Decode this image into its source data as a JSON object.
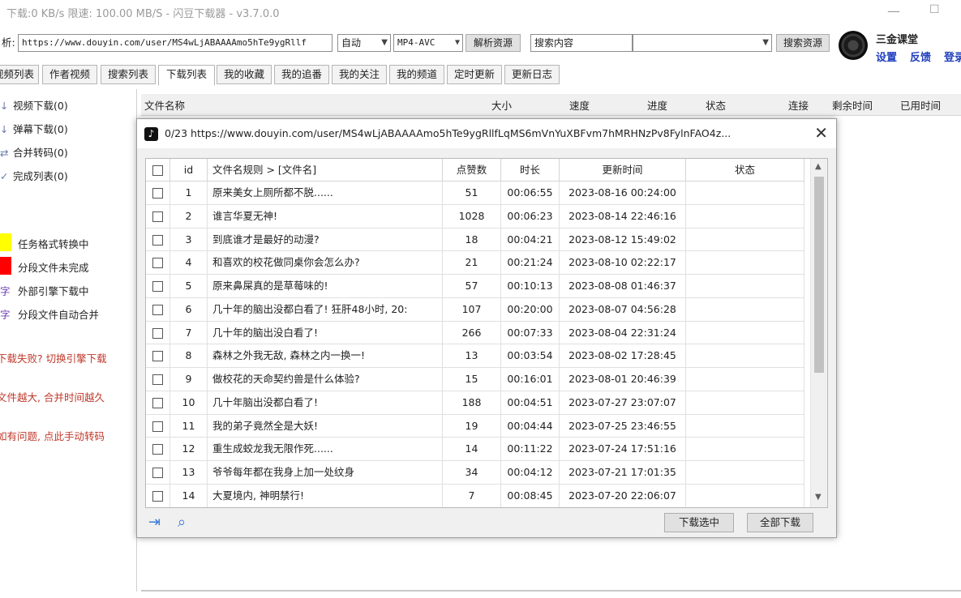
{
  "window": {
    "title": "下载:0 KB/s  限速: 100.00 MB/S  - 闪豆下载器 - v3.7.0.0"
  },
  "toolbar": {
    "parse_label_fragment": "析:",
    "url_value": "https://www.douyin.com/user/MS4wLjABAAAAmo5hTe9ygRllf",
    "mode_value": "自动",
    "format_value": "MP4-AVC",
    "parse_button": "解析资源",
    "search_value": "搜索内容",
    "search_button": "搜索资源"
  },
  "user": {
    "name": "三金课堂",
    "settings": "设置",
    "feedback": "反馈",
    "login_fragment": "登录"
  },
  "tabs": [
    "视频列表",
    "作者视频",
    "搜索列表",
    "下载列表",
    "我的收藏",
    "我的追番",
    "我的关注",
    "我的频道",
    "定时更新",
    "更新日志"
  ],
  "active_tab_index": 3,
  "left_panel": {
    "items": [
      {
        "icon": "arrow-down-icon",
        "glyph": "↓",
        "label": "视频下载(0)"
      },
      {
        "icon": "arrow-down-icon",
        "glyph": "↓",
        "label": "弹幕下载(0)"
      },
      {
        "icon": "merge-icon",
        "glyph": "⇄",
        "label": "合并转码(0)"
      },
      {
        "icon": "check-icon",
        "glyph": "✓",
        "label": "完成列表(0)"
      }
    ],
    "legend": [
      {
        "color": "#ffff00",
        "label": "任务格式转换中"
      },
      {
        "color": "#ff0000",
        "label": "分段文件未完成"
      },
      {
        "glyph": "字",
        "glyph_color": "#6c3fb5",
        "label": "外部引擎下载中"
      },
      {
        "glyph": "字",
        "glyph_color": "#6c3fb5",
        "label": "分段文件自动合并"
      }
    ],
    "hints": [
      "下载失败? 切换引擎下载",
      "文件越大, 合并时间越久",
      "如有问题, 点此手动转码"
    ]
  },
  "main_header": [
    "文件名称",
    "大小",
    "速度",
    "进度",
    "状态",
    "连接",
    "剩余时间",
    "已用时间"
  ],
  "dialog": {
    "title": "0/23 https://www.douyin.com/user/MS4wLjABAAAAmo5hTe9ygRllfLqMS6mVnYuXBFvm7hMRHNzPv8FylnFAO4z...",
    "columns": [
      "",
      "id",
      "文件名规则  >  [文件名]",
      "点赞数",
      "时长",
      "更新时间",
      "状态"
    ],
    "rows": [
      {
        "id": "1",
        "name": "原来美女上厕所都不脱......",
        "likes": "51",
        "duration": "00:06:55",
        "updated": "2023-08-16 00:24:00",
        "status": ""
      },
      {
        "id": "2",
        "name": "谁言华夏无神!",
        "likes": "1028",
        "duration": "00:06:23",
        "updated": "2023-08-14 22:46:16",
        "status": ""
      },
      {
        "id": "3",
        "name": "到底谁才是最好的动漫?",
        "likes": "18",
        "duration": "00:04:21",
        "updated": "2023-08-12 15:49:02",
        "status": ""
      },
      {
        "id": "4",
        "name": "和喜欢的校花做同桌你会怎么办?",
        "likes": "21",
        "duration": "00:21:24",
        "updated": "2023-08-10 02:22:17",
        "status": ""
      },
      {
        "id": "5",
        "name": "原来鼻屎真的是草莓味的!",
        "likes": "57",
        "duration": "00:10:13",
        "updated": "2023-08-08 01:46:37",
        "status": ""
      },
      {
        "id": "6",
        "name": "几十年的脑出没都白看了! 狂肝48小时, 20:",
        "likes": "107",
        "duration": "00:20:00",
        "updated": "2023-08-07 04:56:28",
        "status": ""
      },
      {
        "id": "7",
        "name": "几十年的脑出没白看了!",
        "likes": "266",
        "duration": "00:07:33",
        "updated": "2023-08-04 22:31:24",
        "status": ""
      },
      {
        "id": "8",
        "name": "森林之外我无敌, 森林之内一换一!",
        "likes": "13",
        "duration": "00:03:54",
        "updated": "2023-08-02 17:28:45",
        "status": ""
      },
      {
        "id": "9",
        "name": "做校花的天命契约兽是什么体验?",
        "likes": "15",
        "duration": "00:16:01",
        "updated": "2023-08-01 20:46:39",
        "status": ""
      },
      {
        "id": "10",
        "name": "几十年脑出没都白看了!",
        "likes": "188",
        "duration": "00:04:51",
        "updated": "2023-07-27 23:07:07",
        "status": ""
      },
      {
        "id": "11",
        "name": "我的弟子竟然全是大妖!",
        "likes": "19",
        "duration": "00:04:44",
        "updated": "2023-07-25 23:46:55",
        "status": ""
      },
      {
        "id": "12",
        "name": "重生成蛟龙我无限作死......",
        "likes": "14",
        "duration": "00:11:22",
        "updated": "2023-07-24 17:51:16",
        "status": ""
      },
      {
        "id": "13",
        "name": "爷爷每年都在我身上加一处纹身",
        "likes": "34",
        "duration": "00:04:12",
        "updated": "2023-07-21 17:01:35",
        "status": ""
      },
      {
        "id": "14",
        "name": "大夏境内, 神明禁行!",
        "likes": "7",
        "duration": "00:08:45",
        "updated": "2023-07-20 22:06:07",
        "status": ""
      }
    ],
    "download_selected": "下载选中",
    "download_all": "全部下载"
  }
}
